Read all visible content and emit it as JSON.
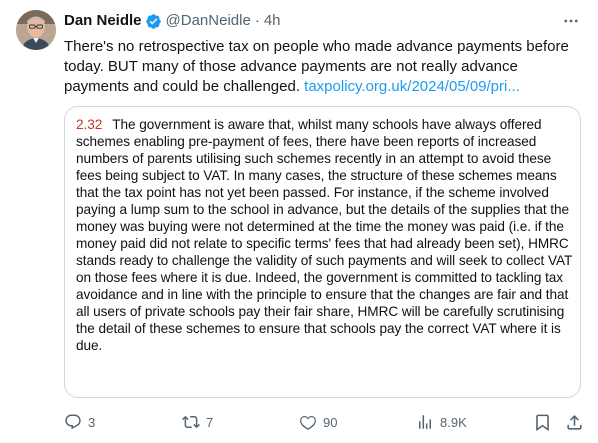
{
  "author": {
    "display_name": "Dan Neidle",
    "handle": "@DanNeidle",
    "dot": "·",
    "time": "4h"
  },
  "tweet": {
    "text": "There's no retrospective tax on people who made advance payments before today. BUT many of those advance payments are not really advance payments and could be challenged. ",
    "link_text": "taxpolicy.org.uk/2024/05/09/pri..."
  },
  "card": {
    "paragraph_number": "2.32",
    "paragraph_text": "The government is aware that, whilst many schools have always offered schemes enabling pre-payment of fees, there have been reports of increased numbers of parents utilising such schemes recently in an attempt to avoid these fees being subject to VAT. In many cases, the structure of these schemes means that the tax point has not yet been passed. For instance, if the scheme involved paying a lump sum to the school in advance, but the details of the supplies that the money was buying were not determined at the time the money was paid (i.e. if the money paid did not relate to specific terms' fees that had already been set), HMRC stands ready to challenge the validity of such payments and will seek to collect VAT on those fees where it is due. Indeed, the government is committed to tackling tax avoidance and in line with the principle to ensure that the changes are fair and that all users of private schools pay their fair share, HMRC will be carefully scrutinising the detail of these schemes to ensure that schools pay the correct VAT where it is due."
  },
  "actions": {
    "replies": "3",
    "retweets": "7",
    "likes": "90",
    "views": "8.9K"
  },
  "icons": {
    "verified": "verified-badge-icon",
    "more": "more-horizontal-icon",
    "reply": "reply-icon",
    "retweet": "retweet-icon",
    "like": "heart-icon",
    "views": "views-bar-chart-icon",
    "bookmark": "bookmark-icon",
    "share": "share-icon"
  },
  "colors": {
    "link": "#1d9bf0",
    "verified": "#1d9bf0",
    "paragraph_number": "#c0392b",
    "secondary_text": "#536471",
    "card_border": "#cfd9de"
  }
}
